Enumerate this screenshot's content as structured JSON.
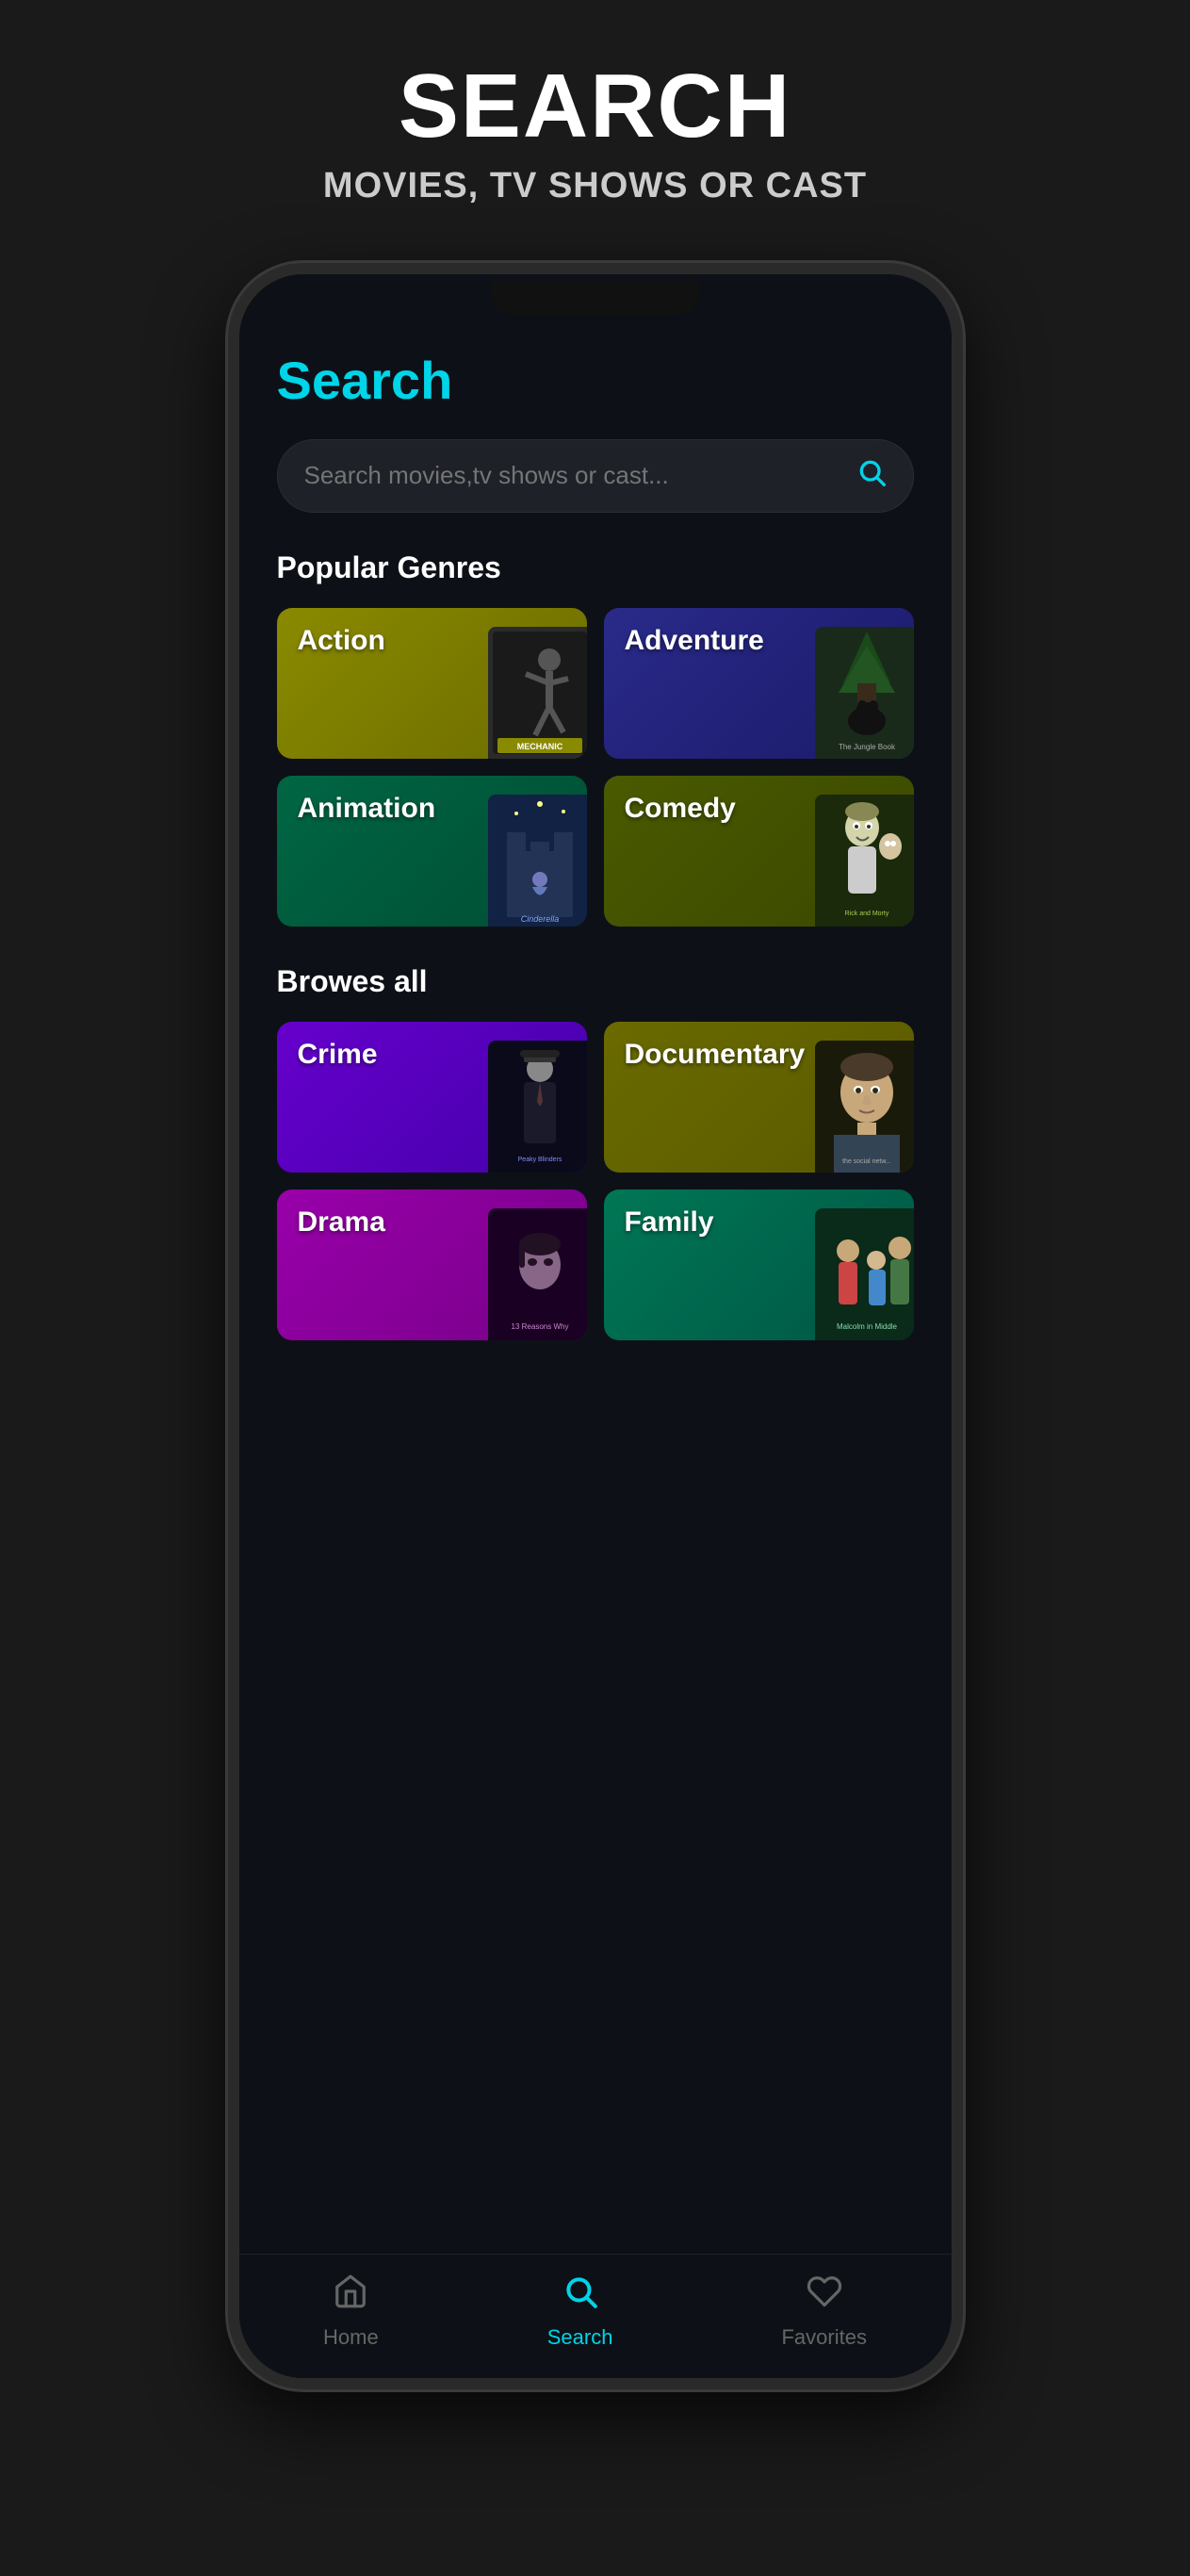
{
  "hero": {
    "title": "SEARCH",
    "subtitle": "MOVIES, TV SHOWS OR CAST"
  },
  "page": {
    "title": "Search"
  },
  "search": {
    "placeholder": "Search movies,tv shows or cast..."
  },
  "sections": {
    "popular_genres": "Popular Genres",
    "browse_all": "Browes all"
  },
  "genres": {
    "popular": [
      {
        "id": "action",
        "label": "Action",
        "colorClass": "genre-action",
        "posterClass": "poster-mechanic"
      },
      {
        "id": "adventure",
        "label": "Adventure",
        "colorClass": "genre-adventure",
        "posterClass": "poster-jungle"
      },
      {
        "id": "animation",
        "label": "Animation",
        "colorClass": "genre-animation",
        "posterClass": "poster-cinderella"
      },
      {
        "id": "comedy",
        "label": "Comedy",
        "colorClass": "genre-comedy",
        "posterClass": "poster-rick"
      }
    ],
    "all": [
      {
        "id": "crime",
        "label": "Crime",
        "colorClass": "genre-crime",
        "posterClass": "poster-peaky"
      },
      {
        "id": "documentary",
        "label": "Documentary",
        "colorClass": "genre-documentary",
        "posterClass": "poster-social"
      },
      {
        "id": "drama",
        "label": "Drama",
        "colorClass": "genre-drama",
        "posterClass": "poster-drama-show"
      },
      {
        "id": "family",
        "label": "Family",
        "colorClass": "genre-family",
        "posterClass": "poster-malcolm"
      }
    ]
  },
  "nav": {
    "items": [
      {
        "id": "home",
        "label": "Home",
        "icon": "⌂",
        "active": false
      },
      {
        "id": "search",
        "label": "Search",
        "icon": "⊕",
        "active": true
      },
      {
        "id": "favorites",
        "label": "Favorites",
        "icon": "♡",
        "active": false
      }
    ]
  }
}
